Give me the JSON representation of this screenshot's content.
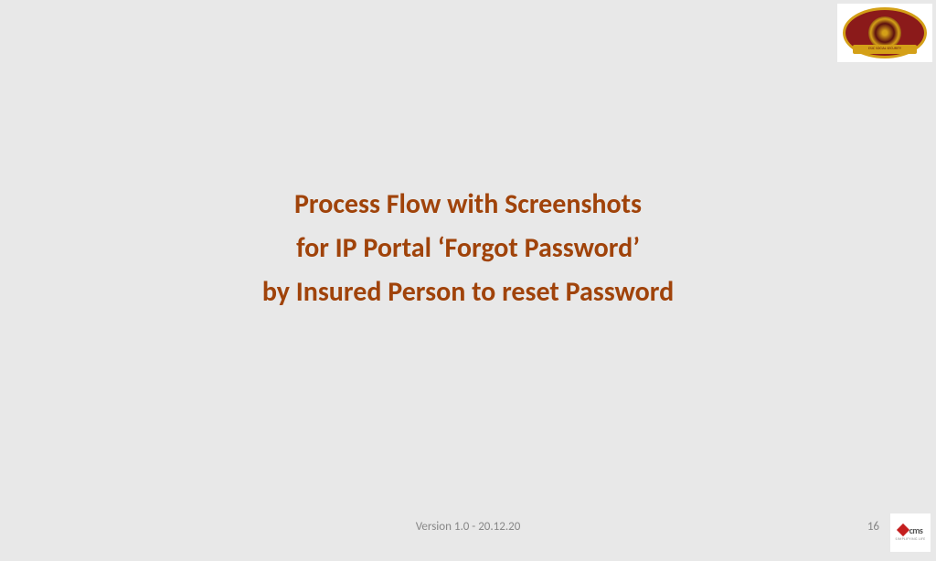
{
  "title": {
    "line1": "Process Flow with Screenshots",
    "line2": "for IP Portal ‘Forgot Password’",
    "line3": "by Insured Person to reset Password"
  },
  "footer": {
    "version": "Version 1.0 - 20.12.20",
    "page": "16"
  },
  "logos": {
    "top_right_label": "ESIC SOCIAL SECURITY",
    "bottom_right_text": "cms",
    "bottom_right_tagline": "SIMPLIFYING LIFE"
  }
}
